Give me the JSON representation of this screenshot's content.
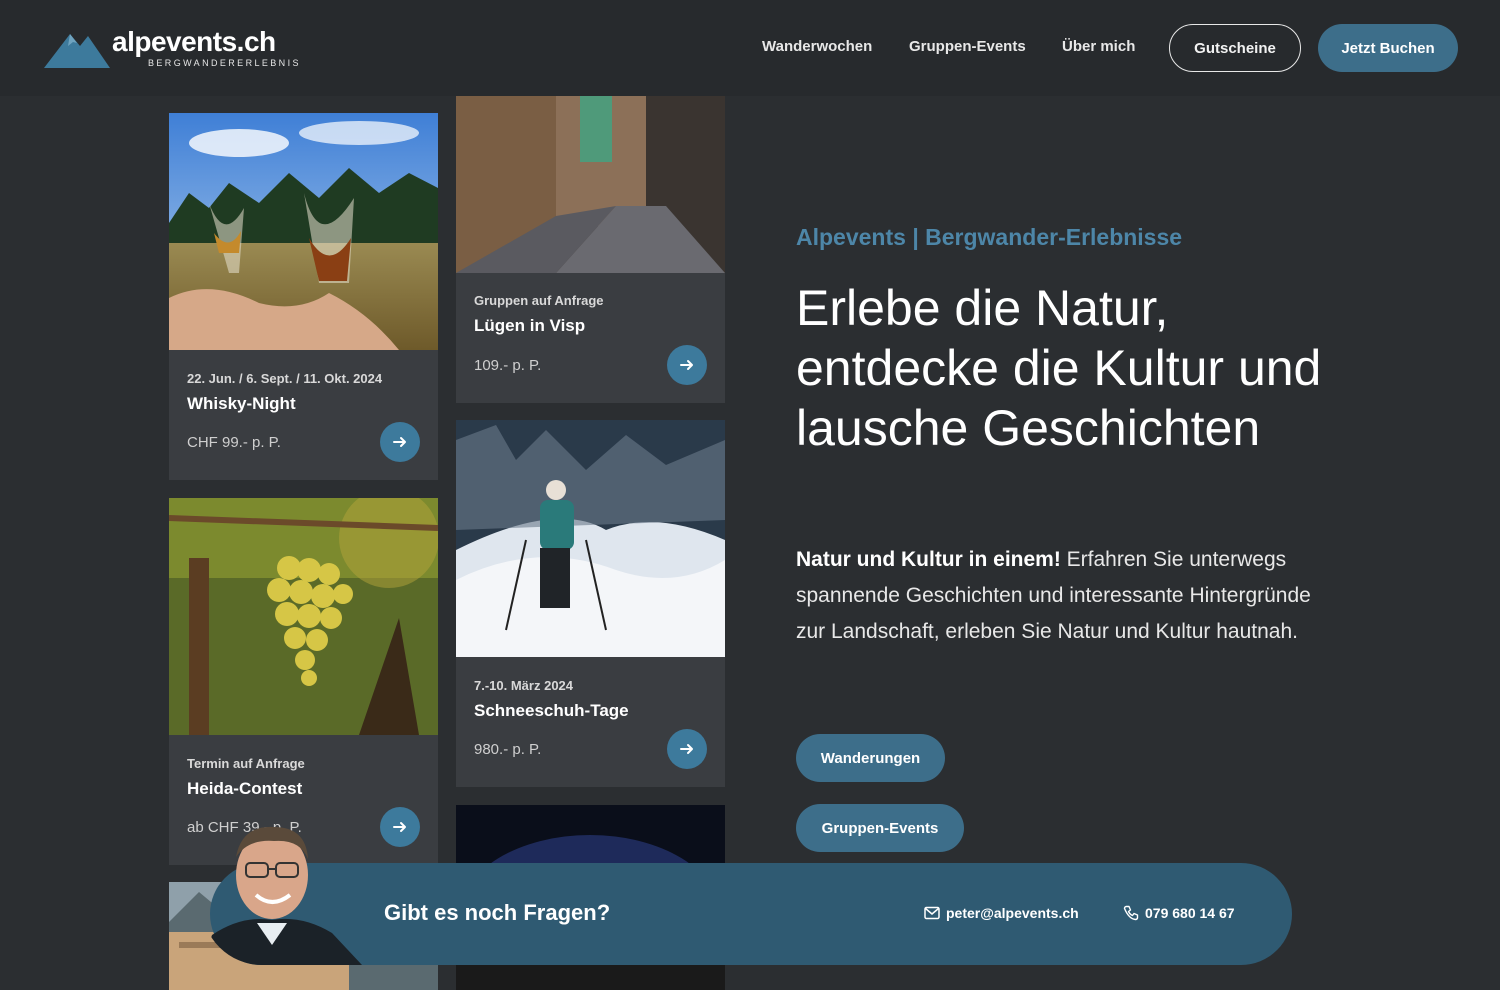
{
  "brand": {
    "name": "alpevents.ch",
    "tagline": "BERGWANDERERLEBNIS",
    "color_primary": "#3d6e8a",
    "color_accent_text": "#4d86a8",
    "color_background": "#2b2e31"
  },
  "nav": {
    "items": [
      {
        "label": "Wanderwochen"
      },
      {
        "label": "Gruppen-Events"
      },
      {
        "label": "Über mich"
      }
    ],
    "vouchers_label": "Gutscheine",
    "book_label": "Jetzt Buchen"
  },
  "cards": [
    {
      "subtitle": "22. Jun. / 6. Sept. / 11. Okt. 2024",
      "title": "Whisky-Night",
      "price": "CHF 99.- p. P.",
      "image": "whisky-glasses-meadow"
    },
    {
      "subtitle": "Gruppen auf Anfrage",
      "title": "Lügen in Visp",
      "price": "109.- p. P.",
      "image": "old-town-alley"
    },
    {
      "subtitle": "Termin auf Anfrage",
      "title": "Heida-Contest",
      "price": "ab CHF 39.- p. P.",
      "image": "grape-cluster"
    },
    {
      "subtitle": "7.-10. März 2024",
      "title": "Schneeschuh-Tage",
      "price": "980.- p. P.",
      "image": "snowshoe-hiker"
    }
  ],
  "hero": {
    "eyebrow": "Alpevents | Bergwander-Erlebnisse",
    "headline": "Erlebe die Natur, entdecke die Kultur und lausche Geschichten",
    "intro_bold": "Natur und Kultur in einem!",
    "intro_text": " Erfahren Sie unterwegs spannende Geschichten und interessante Hintergründe zur Landschaft, erleben Sie Natur und Kultur hautnah.",
    "button_hikes": "Wanderungen",
    "button_groups": "Gruppen-Events"
  },
  "contact": {
    "question": "Gibt es noch Fragen?",
    "email": "peter@alpevents.ch",
    "phone": "079 680 14 67"
  }
}
